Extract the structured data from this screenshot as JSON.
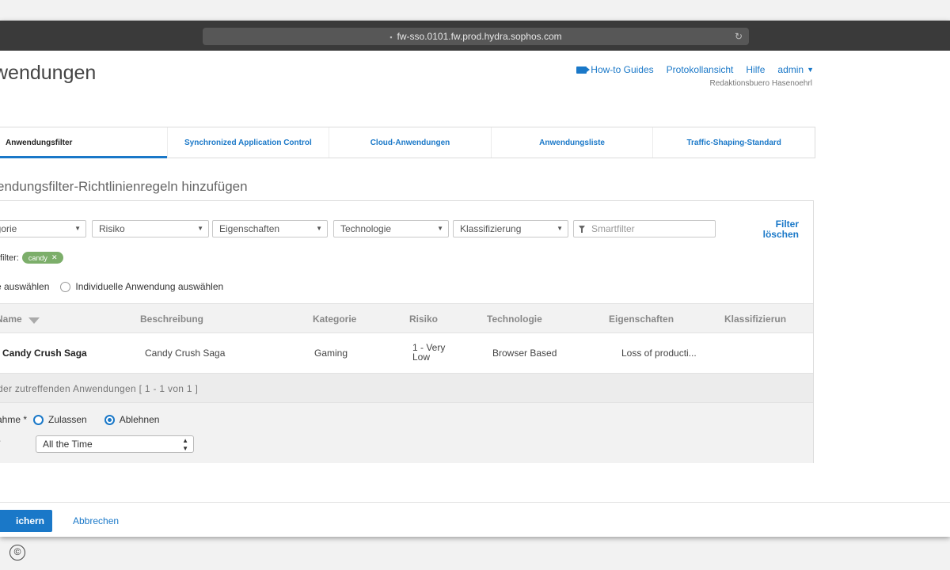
{
  "browser": {
    "url": "fw-sso.0101.fw.prod.hydra.sophos.com"
  },
  "page": {
    "title": "wendungen"
  },
  "topnav": {
    "howto": "How-to Guides",
    "log": "Protokollansicht",
    "help": "Hilfe",
    "user": "admin",
    "org": "Redaktionsbuero Hasenoehrl"
  },
  "tabs": [
    {
      "label": "Anwendungsfilter",
      "active": true
    },
    {
      "label": "Synchronized Application Control"
    },
    {
      "label": "Cloud-Anwendungen"
    },
    {
      "label": "Anwendungsliste"
    },
    {
      "label": "Traffic-Shaping-Standard"
    }
  ],
  "section": {
    "title": "endungsfilter-Richtlinienregeln hinzufügen"
  },
  "filters": {
    "category": "egorie",
    "risk": "Risiko",
    "properties": "Eigenschaften",
    "technology": "Technologie",
    "classification": "Klassifizierung",
    "smartfilter_placeholder": "Smartfilter",
    "clear_line1": "Filter",
    "clear_line2": "löschen"
  },
  "smartfilter": {
    "label": "tfilter:",
    "chip": "candy"
  },
  "selection": {
    "all": "e auswählen",
    "individual": "Individuelle Anwendung auswählen"
  },
  "table": {
    "headers": {
      "name": "Name",
      "description": "Beschreibung",
      "category": "Kategorie",
      "risk": "Risiko",
      "technology": "Technologie",
      "properties": "Eigenschaften",
      "classification": "Klassifizierun"
    },
    "rows": [
      {
        "name": "Candy Crush Saga",
        "description": "Candy Crush Saga",
        "category": "Gaming",
        "risk_line1": "1 - Very",
        "risk_line2": "Low",
        "technology": "Browser Based",
        "properties": "Loss of producti..."
      }
    ],
    "footer": "der zutreffenden Anwendungen [ 1 - 1 von 1 ]"
  },
  "action": {
    "label": "ahme *",
    "allow": "Zulassen",
    "deny": "Ablehnen",
    "selected": "deny",
    "time_label": "*",
    "time_value": "All the Time"
  },
  "footer": {
    "save": "ichern",
    "cancel": "Abbrechen"
  },
  "colors": {
    "accent": "#1a78c8",
    "chip": "#7cae6a",
    "browser_bar": "#3a3a3a"
  },
  "copyright_symbol": "©"
}
